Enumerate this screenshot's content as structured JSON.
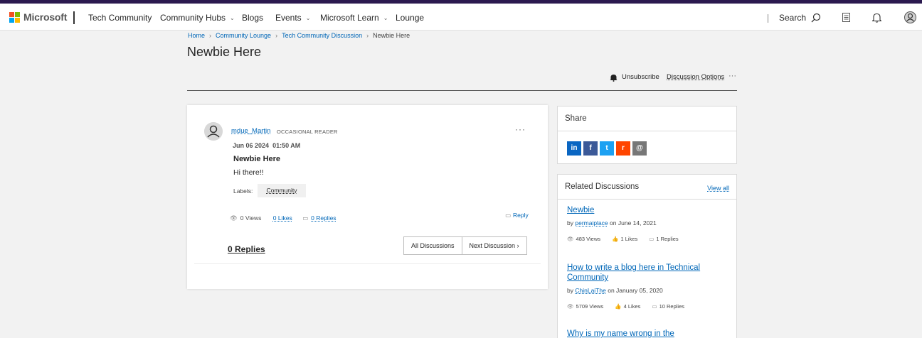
{
  "brand": {
    "name": "Microsoft",
    "logo_colors": [
      "#f25022",
      "#7fba00",
      "#00a4ef",
      "#ffb900"
    ]
  },
  "nav": {
    "site": "Tech Community",
    "items": [
      "Community Hubs",
      "Blogs",
      "Events",
      "Microsoft Learn",
      "Lounge"
    ],
    "search_label": "Search"
  },
  "breadcrumb": [
    "Home",
    "Community Lounge",
    "Tech Community Discussion",
    "Newbie Here"
  ],
  "page_title": "Newbie Here",
  "actions": {
    "unsubscribe": "Unsubscribe",
    "options": "Discussion Options",
    "more": "···"
  },
  "post": {
    "author": "mdue_Martin",
    "rank": "OCCASIONAL READER",
    "menu": "···",
    "date": "Jun 06 2024",
    "time": "01:50 AM",
    "title": "Newbie Here",
    "body": "Hi there!!",
    "labels_label": "Labels:",
    "label": "Community",
    "views": "0 Views",
    "likes": "0 Likes",
    "replies": "0 Replies",
    "reply_button": "Reply",
    "replies_heading": "0 Replies",
    "all_discussions": "All Discussions",
    "next_discussion": "Next Discussion"
  },
  "share": {
    "title": "Share",
    "icons": [
      {
        "name": "linkedin-icon",
        "glyph": "in",
        "color": "#0a66c2"
      },
      {
        "name": "facebook-icon",
        "glyph": "f",
        "color": "#3b5998"
      },
      {
        "name": "twitter-icon",
        "glyph": "t",
        "color": "#1da1f2"
      },
      {
        "name": "reddit-icon",
        "glyph": "r",
        "color": "#ff4500"
      },
      {
        "name": "email-icon",
        "glyph": "@",
        "color": "#777777"
      }
    ]
  },
  "related": {
    "title": "Related Discussions",
    "view_all": "View all",
    "items": [
      {
        "title": "Newbie",
        "by": "by",
        "author": "permaiplace",
        "on": "on June 14, 2021",
        "views": "483 Views",
        "likes": "1 Likes",
        "replies": "1 Replies"
      },
      {
        "title": "How to write a blog here in Technical Community",
        "by": "by",
        "author": "ChinLaiThe",
        "on": "on January 05, 2020",
        "views": "5709 Views",
        "likes": "4 Likes",
        "replies": "10 Replies"
      },
      {
        "title": "Why is my name wrong in the"
      }
    ]
  }
}
